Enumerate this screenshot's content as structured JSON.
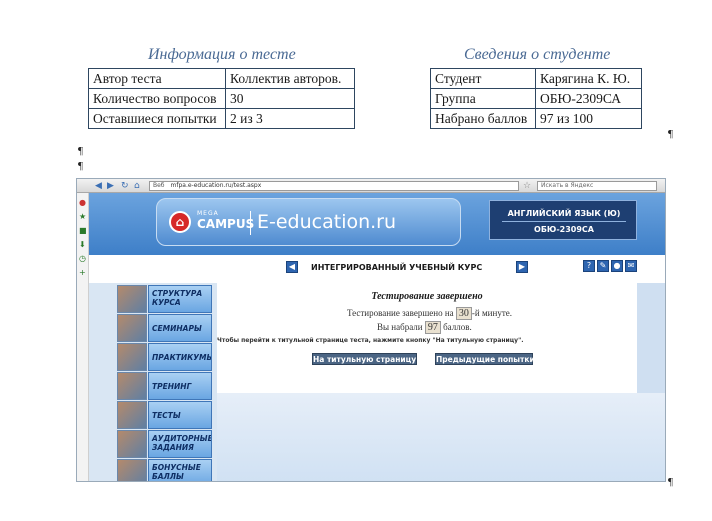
{
  "test_info": {
    "heading": "Информация о тесте",
    "rows": [
      {
        "label": "Автор теста",
        "value": "Коллектив авторов."
      },
      {
        "label": "Количество вопросов",
        "value": "30"
      },
      {
        "label": "Оставшиеся попытки",
        "value": "2 из 3"
      }
    ]
  },
  "student_info": {
    "heading": "Сведения о студенте",
    "rows": [
      {
        "label": "Студент",
        "value": "Карягина К. Ю."
      },
      {
        "label": "Группа",
        "value": "ОБЮ-2309СА"
      },
      {
        "label": "Набрано баллов",
        "value": "97 из 100"
      }
    ]
  },
  "pilcrow": "¶",
  "browser": {
    "address_tag": "Веб",
    "url": "mfpa.e-education.ru/test.aspx",
    "search_placeholder": "Искать в Яндекс"
  },
  "site": {
    "logo_mega": "MEGA",
    "logo_campus": "CAMPUS",
    "logo_name": "E-education.ru",
    "course_name": "АНГЛИЙСКИЙ ЯЗЫК (Ю)",
    "course_group": "ОБЮ-2309СА",
    "nav_title": "ИНТЕГРИРОВАННЫЙ УЧЕБНЫЙ КУРС",
    "menu": [
      "Структура курса",
      "Семинары",
      "Практикумы",
      "Тренинг",
      "Тесты",
      "Аудиторные задания",
      "Бонусные баллы"
    ],
    "result": {
      "title": "Тестирование завершено",
      "line1_prefix": "Тестирование завершено на",
      "minute": "30",
      "line1_suffix": "-й минуте.",
      "line2_prefix": "Вы набрали",
      "score": "97",
      "line2_suffix": "баллов.",
      "hint": "Чтобы перейти к титульной странице теста, нажмите кнопку \"На титульную страницу\".",
      "btn_title_page": "На титульную страницу",
      "btn_prev_attempts": "Предыдущие попытки"
    }
  }
}
